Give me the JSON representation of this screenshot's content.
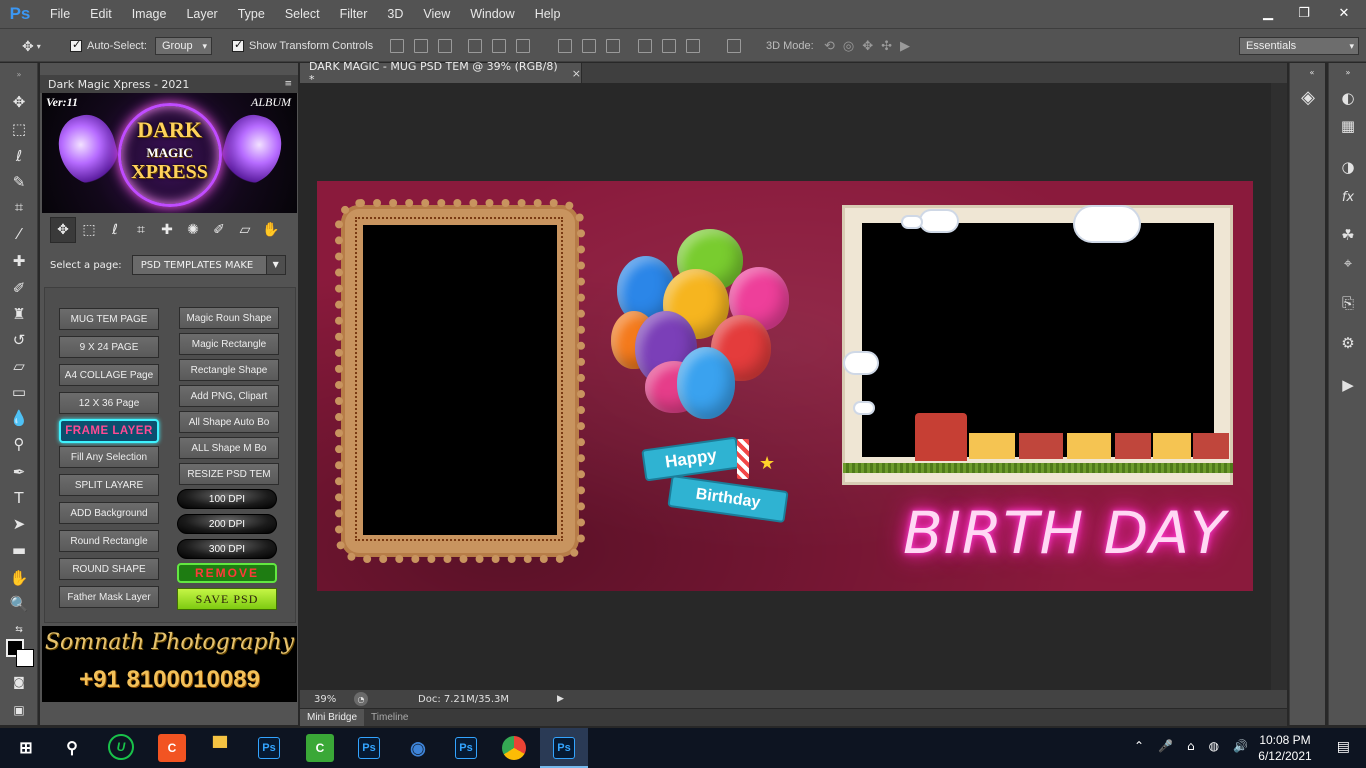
{
  "app": {
    "logo": "Ps",
    "menu": [
      "File",
      "Edit",
      "Image",
      "Layer",
      "Type",
      "Select",
      "Filter",
      "3D",
      "View",
      "Window",
      "Help"
    ],
    "window_controls": {
      "minimize": "▁",
      "restore": "❐",
      "close": "✕"
    }
  },
  "options_bar": {
    "auto_select_label": "Auto-Select:",
    "auto_select_value": "Group",
    "show_transform_label": "Show Transform Controls",
    "mode_3d_label": "3D Mode:",
    "workspace": "Essentials"
  },
  "panel": {
    "title": "Dark Magic Xpress - 2021",
    "banner": {
      "version": "Ver:11",
      "album": "ALBUM",
      "line1": "DARK",
      "line2": "MAGIC",
      "line3": "XPRESS"
    },
    "select_page_label": "Select a page:",
    "select_page_value": "PSD TEMPLATES MAKE",
    "left_buttons": [
      "MUG TEM PAGE",
      "9 X 24 PAGE",
      "A4 COLLAGE Page",
      "12 X 36 Page",
      "FRAME LAYER",
      "Fill Any Selection",
      "SPLIT LAYARE",
      "ADD Background",
      "Round Rectangle",
      "ROUND SHAPE",
      "Father Mask Layer"
    ],
    "right_buttons": [
      "Magic Roun Shape",
      "Magic Rectangle",
      "Rectangle Shape",
      "Add PNG, Clipart",
      "All Shape Auto Bo",
      "ALL Shape M Bo",
      "RESIZE PSD TEM"
    ],
    "dpi_buttons": [
      "100 DPI",
      "200 DPI",
      "300 DPI"
    ],
    "remove_label": "REMOVE",
    "save_label": "SAVE  PSD",
    "footer_name": "Somnath Photography",
    "footer_phone": "+91 8100010089"
  },
  "document": {
    "tab_title": "DARK MAGIC - MUG PSD TEM @ 39% (RGB/8) *",
    "tab_close": "×",
    "zoom": "39%",
    "doc_size": "Doc: 7.21M/35.3M",
    "artwork": {
      "ribbon_top": "Happy",
      "ribbon_bottom": "Birthday",
      "neon_text": "BIRTH DAY"
    }
  },
  "bottom_tabs": [
    "Mini Bridge",
    "Timeline"
  ],
  "taskbar": {
    "time": "10:08 PM",
    "date": "6/12/2021"
  },
  "colors": {
    "ps_blue": "#3b97f3",
    "chrome_bg": "#535353",
    "canvas_bg": "#282828",
    "art_bg": "#8a1a3c",
    "neon_pink": "#ff2bc4",
    "taskbar": "#0d1421"
  }
}
